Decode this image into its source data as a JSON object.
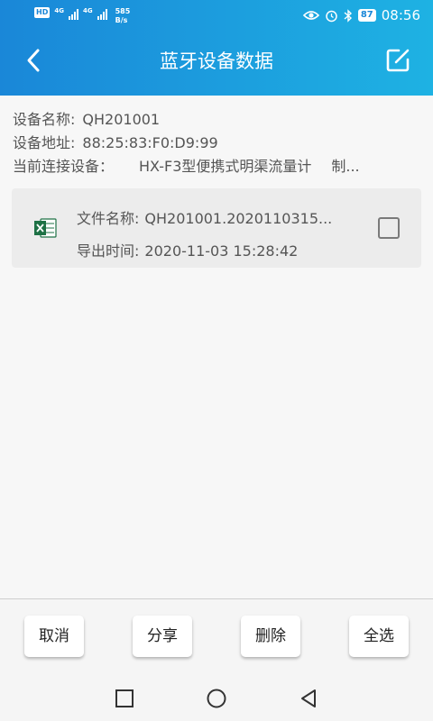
{
  "status_bar": {
    "hd_label": "HD",
    "net1_label": "4G",
    "net2_label": "4G",
    "net_speed_value": "585",
    "net_speed_unit": "B/s",
    "battery_level": "87",
    "time": "08:56"
  },
  "header": {
    "title": "蓝牙设备数据",
    "back_icon": "chevron-left-icon",
    "edit_icon": "edit-square-icon"
  },
  "device_info": {
    "name_label": "设备名称:",
    "name_value": "QH201001",
    "address_label": "设备地址:",
    "address_value": "88:25:83:F0:D9:99",
    "connected_label": "当前连接设备：",
    "connected_value": "HX-F3型便携式明渠流量计",
    "connected_extra": "制..."
  },
  "files": [
    {
      "icon": "excel-file-icon",
      "name_label": "文件名称:",
      "name_value": "QH201001.2020110315...",
      "time_label": "导出时间:",
      "time_value": "2020-11-03 15:28:42",
      "checked": false
    }
  ],
  "actions": {
    "cancel_label": "取消",
    "share_label": "分享",
    "delete_label": "删除",
    "select_all_label": "全选"
  },
  "nav": {
    "recents_icon": "square-recents-icon",
    "home_icon": "circle-home-icon",
    "back_icon": "triangle-back-icon"
  },
  "colors": {
    "header_start": "#1a87d8",
    "header_end": "#1eb2e3",
    "excel_green": "#1e7145"
  }
}
